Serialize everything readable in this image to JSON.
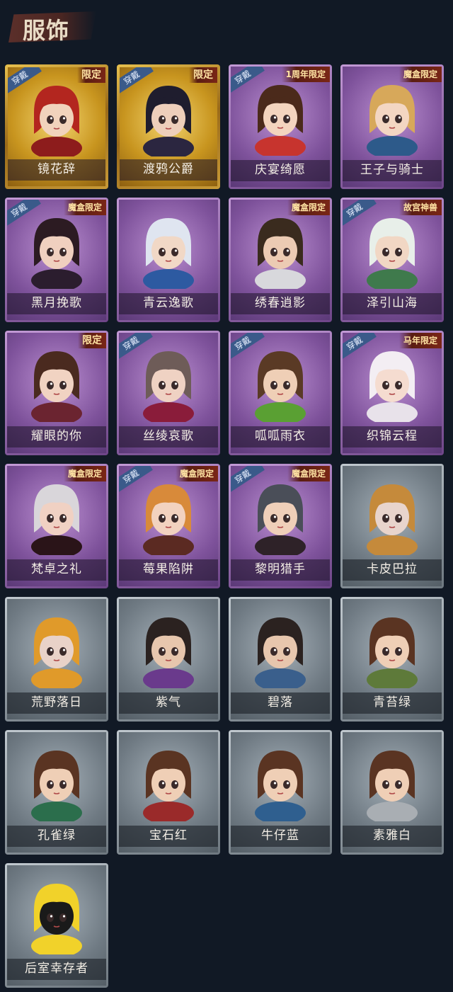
{
  "page": {
    "title": "服饰"
  },
  "costumes": [
    {
      "name": "镜花辞",
      "tier": "gold",
      "wear": "穿戴",
      "badge": "限定",
      "hair": "#b3261f",
      "skin": "#f1d3bc",
      "outfit": "#8d1c1c"
    },
    {
      "name": "渡鸦公爵",
      "tier": "gold",
      "wear": "穿戴",
      "badge": "限定",
      "hair": "#1f1d2e",
      "skin": "#eecfbb",
      "outfit": "#2b2640"
    },
    {
      "name": "庆宴绮愿",
      "tier": "purple",
      "wear": "穿戴",
      "badge": "1周年限定",
      "hair": "#4b2a1b",
      "skin": "#f3d4be",
      "outfit": "#c7342e"
    },
    {
      "name": "王子与骑士",
      "tier": "purple",
      "wear": "",
      "badge": "魔盒限定",
      "hair": "#d7a85a",
      "skin": "#f3d6c2",
      "outfit": "#2d5a8a"
    },
    {
      "name": "黑月挽歌",
      "tier": "purple",
      "wear": "穿戴",
      "badge": "魔盒限定",
      "hair": "#2c1b22",
      "skin": "#f0d0bf",
      "outfit": "#2b1d2e"
    },
    {
      "name": "青云逸歌",
      "tier": "purple",
      "wear": "",
      "badge": "",
      "hair": "#dfe5f0",
      "skin": "#f1d8c6",
      "outfit": "#2d5aa1"
    },
    {
      "name": "绣春逍影",
      "tier": "purple",
      "wear": "",
      "badge": "魔盒限定",
      "hair": "#3a2b1e",
      "skin": "#eccbb3",
      "outfit": "#d8d8dc"
    },
    {
      "name": "泽引山海",
      "tier": "purple",
      "wear": "穿戴",
      "badge": "故宫神兽",
      "hair": "#e8efe9",
      "skin": "#f1d7c4",
      "outfit": "#3f7a4c"
    },
    {
      "name": "耀眼的你",
      "tier": "purple",
      "wear": "",
      "badge": "限定",
      "hair": "#4a2a1f",
      "skin": "#f1d3c2",
      "outfit": "#6b2430"
    },
    {
      "name": "丝绫哀歌",
      "tier": "purple",
      "wear": "穿戴",
      "badge": "",
      "hair": "#6e5c58",
      "skin": "#efd2c3",
      "outfit": "#8a1c3a"
    },
    {
      "name": "呱呱雨衣",
      "tier": "purple",
      "wear": "穿戴",
      "badge": "",
      "hair": "#5a3a25",
      "skin": "#efcfb6",
      "outfit": "#5aa033"
    },
    {
      "name": "织锦云程",
      "tier": "purple",
      "wear": "穿戴",
      "badge": "马年限定",
      "hair": "#f3eef3",
      "skin": "#f5dcd0",
      "outfit": "#e8e2ea"
    },
    {
      "name": "梵卓之礼",
      "tier": "purple",
      "wear": "",
      "badge": "魔盒限定",
      "hair": "#d9d6da",
      "skin": "#f0d1c3",
      "outfit": "#2a1418"
    },
    {
      "name": "莓果陷阱",
      "tier": "purple",
      "wear": "穿戴",
      "badge": "魔盒限定",
      "hair": "#d88a3a",
      "skin": "#f2d2bf",
      "outfit": "#5b2a22"
    },
    {
      "name": "黎明猎手",
      "tier": "purple",
      "wear": "穿戴",
      "badge": "魔盒限定",
      "hair": "#4a4e58",
      "skin": "#efcfb9",
      "outfit": "#2e2228"
    },
    {
      "name": "卡皮巴拉",
      "tier": "gray",
      "wear": "",
      "badge": "",
      "hair": "#c58a3b",
      "skin": "#e8d4cc",
      "outfit": "#c58a3b"
    },
    {
      "name": "荒野落日",
      "tier": "gray",
      "wear": "",
      "badge": "",
      "hair": "#e09a2a",
      "skin": "#e9d2c8",
      "outfit": "#e09a2a"
    },
    {
      "name": "紫气",
      "tier": "gray",
      "wear": "",
      "badge": "",
      "hair": "#2b2220",
      "skin": "#e7c6ad",
      "outfit": "#6a3a8c"
    },
    {
      "name": "碧落",
      "tier": "gray",
      "wear": "",
      "badge": "",
      "hair": "#2b2220",
      "skin": "#e7c6ad",
      "outfit": "#3a5f8c"
    },
    {
      "name": "青苔绿",
      "tier": "gray",
      "wear": "",
      "badge": "",
      "hair": "#5a3422",
      "skin": "#efcfb6",
      "outfit": "#5e7a3a"
    },
    {
      "name": "孔雀绿",
      "tier": "gray",
      "wear": "",
      "badge": "",
      "hair": "#5a3422",
      "skin": "#efcfb6",
      "outfit": "#2b6e4c"
    },
    {
      "name": "宝石红",
      "tier": "gray",
      "wear": "",
      "badge": "",
      "hair": "#5a3422",
      "skin": "#efcfb6",
      "outfit": "#9a2a2a"
    },
    {
      "name": "牛仔蓝",
      "tier": "gray",
      "wear": "",
      "badge": "",
      "hair": "#5a3422",
      "skin": "#efcfb6",
      "outfit": "#2f5f8f"
    },
    {
      "name": "素雅白",
      "tier": "gray",
      "wear": "",
      "badge": "",
      "hair": "#5a3422",
      "skin": "#efcfb6",
      "outfit": "#a9aeb3"
    },
    {
      "name": "后室幸存者",
      "tier": "gray",
      "wear": "",
      "badge": "",
      "hair": "#f1d22a",
      "skin": "#1a1a1a",
      "outfit": "#f1d22a"
    }
  ]
}
